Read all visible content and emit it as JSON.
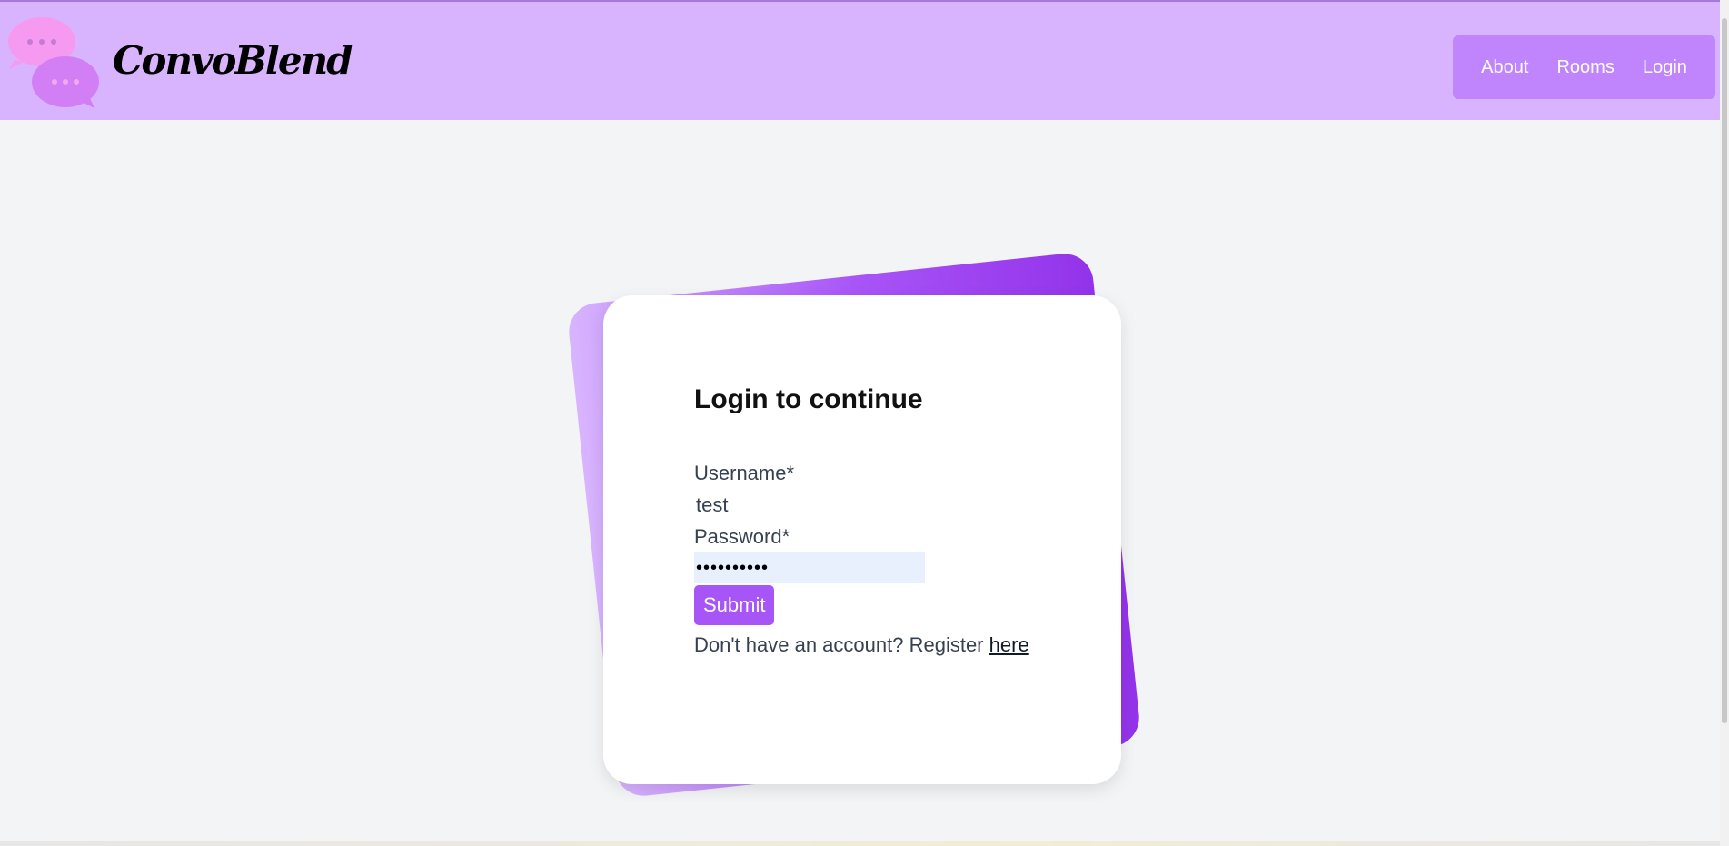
{
  "header": {
    "brand": "ConvoBlend",
    "logo_icon": "chat-bubbles-icon",
    "nav": [
      {
        "label": "About"
      },
      {
        "label": "Rooms"
      },
      {
        "label": "Login"
      }
    ]
  },
  "login": {
    "title": "Login to continue",
    "username_label": "Username*",
    "username_value": "test",
    "password_label": "Password*",
    "password_value": "••••••••••",
    "submit_label": "Submit",
    "register_prompt": "Don't have an account? Register",
    "register_link": "here"
  },
  "colors": {
    "header_bg": "#d8b4fe",
    "nav_bg": "#c084fc",
    "accent": "#a855f7",
    "page_bg": "#f3f4f6"
  }
}
